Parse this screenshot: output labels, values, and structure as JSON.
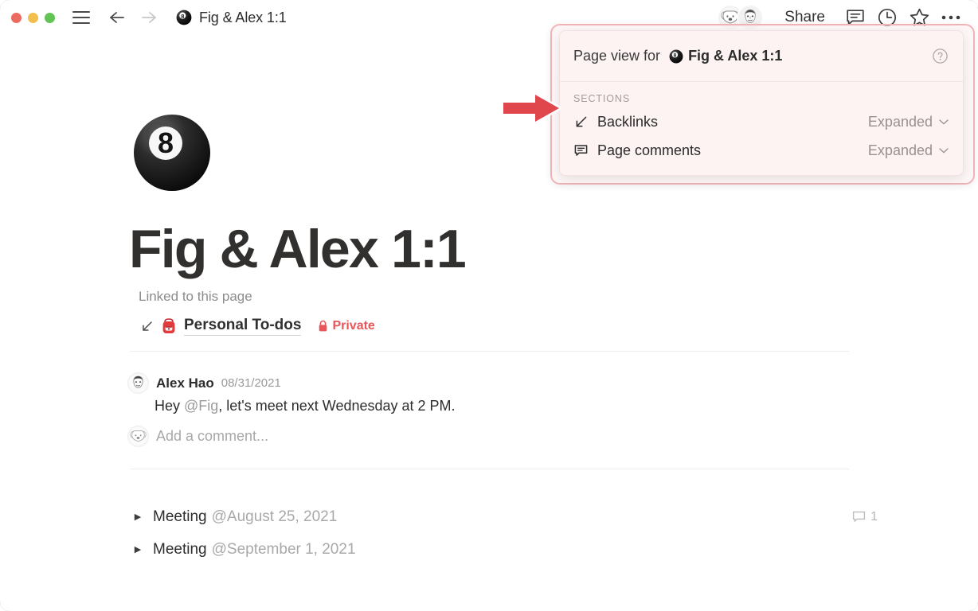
{
  "window": {
    "traffic_lights": [
      "close",
      "minimize",
      "maximize"
    ],
    "colors": {
      "close": "#ec6a5f",
      "minimize": "#f2bf4f",
      "maximize": "#61c454",
      "accent_red": "#e8565a",
      "panel_bg": "#fdf3f3",
      "panel_border": "#f0b4b8"
    }
  },
  "titlebar": {
    "doc_title": "Fig & Alex 1:1",
    "doc_icon": "eight-ball-icon",
    "menu_icon": "hamburger-menu-icon",
    "back_icon": "arrow-left-icon",
    "forward_icon": "arrow-right-icon",
    "share_label": "Share",
    "icons": [
      "comment-icon",
      "history-clock-icon",
      "star-icon",
      "more-options-icon"
    ],
    "avatars": [
      "avatar-koala",
      "avatar-person"
    ]
  },
  "document": {
    "emoji": "eight-ball-emoji",
    "title": "Fig & Alex 1:1",
    "linked_label": "Linked to this page",
    "linked_page": {
      "backlink_icon": "arrow-down-left-icon",
      "emoji": "backpack-emoji",
      "name": "Personal To-dos",
      "lock_icon": "lock-icon",
      "privacy_label": "Private"
    },
    "comment": {
      "author": "Alex Hao",
      "date": "08/31/2021",
      "text_before": "Hey ",
      "mention": "@Fig",
      "text_after": ", let's meet next Wednesday at 2 PM.",
      "full_text": "Hey @Fig, let's meet next Wednesday at 2 PM.",
      "add_comment_placeholder": "Add a comment..."
    },
    "meetings": [
      {
        "toggle": "triangle-right-icon",
        "label": "Meeting",
        "date": "@August 25, 2021",
        "comment_count": "1",
        "has_comments": true
      },
      {
        "toggle": "triangle-right-icon",
        "label": "Meeting",
        "date": "@September 1, 2021",
        "comment_count": "",
        "has_comments": false
      }
    ]
  },
  "page_view_panel": {
    "header_label": "Page view for",
    "header_doc_icon": "eight-ball-icon",
    "header_doc_title": "Fig & Alex 1:1",
    "help_icon": "help-circle-icon",
    "sections_label": "SECTIONS",
    "rows": [
      {
        "icon": "arrow-down-left-icon",
        "label": "Backlinks",
        "value": "Expanded",
        "chevron": "chevron-down-icon"
      },
      {
        "icon": "comment-lines-icon",
        "label": "Page comments",
        "value": "Expanded",
        "chevron": "chevron-down-icon"
      }
    ]
  },
  "annotation": {
    "arrow": "red-arrow-right-annotation"
  }
}
